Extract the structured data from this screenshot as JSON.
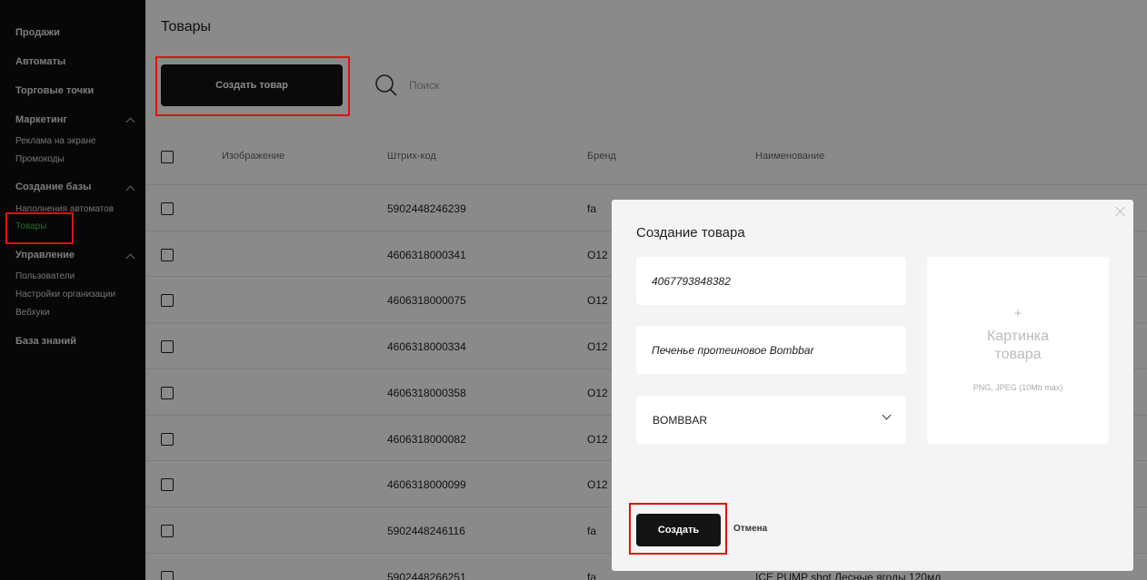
{
  "sidebar": {
    "sales": "Продажи",
    "machines": "Автоматы",
    "outlets": "Торговые точки",
    "marketing": "Маркетинг",
    "screen_ads": "Реклама на экране",
    "promocodes": "Промокоды",
    "base_creation": "Создание базы",
    "machine_fill": "Наполнения автоматов",
    "products": "Товары",
    "management": "Управление",
    "users": "Пользователи",
    "org_settings": "Настройки организации",
    "webhooks": "Вебхуки",
    "knowledge_base": "База знаний"
  },
  "page": {
    "title": "Товары",
    "create_label": "Создать товар",
    "search_placeholder": "Поиск"
  },
  "table": {
    "columns": [
      "Изображение",
      "Штрих-код",
      "Бренд",
      "Наименование"
    ],
    "rows": [
      {
        "barcode": "5902448246239",
        "brand": "fa",
        "name": ""
      },
      {
        "barcode": "4606318000341",
        "brand": "O12",
        "name": ""
      },
      {
        "barcode": "4606318000075",
        "brand": "O12",
        "name": ""
      },
      {
        "barcode": "4606318000334",
        "brand": "O12",
        "name": ""
      },
      {
        "barcode": "4606318000358",
        "brand": "O12",
        "name": ""
      },
      {
        "barcode": "4606318000082",
        "brand": "O12",
        "name": ""
      },
      {
        "barcode": "4606318000099",
        "brand": "O12",
        "name": ""
      },
      {
        "barcode": "5902448246116",
        "brand": "fa",
        "name": ""
      },
      {
        "barcode": "5902448266251",
        "brand": "fa",
        "name": "ICE PUMP shot Лесные ягоды 120мл"
      }
    ]
  },
  "modal": {
    "title": "Создание товара",
    "barcode_value": "4067793848382",
    "name_value": "Печенье протеиновое Bombbar",
    "brand_value": "BOMBBAR",
    "image_plus": "+",
    "image_label_1": "Картинка",
    "image_label_2": "товара",
    "image_hint": "PNG, JPEG (10Mb max)",
    "submit_label": "Создать",
    "cancel_label": "Отмена"
  },
  "colors": {
    "sidebar_bg": "#0d0d0d",
    "active_nav": "#4cc44c",
    "button_bg": "#141414",
    "highlight": "#e01010"
  }
}
